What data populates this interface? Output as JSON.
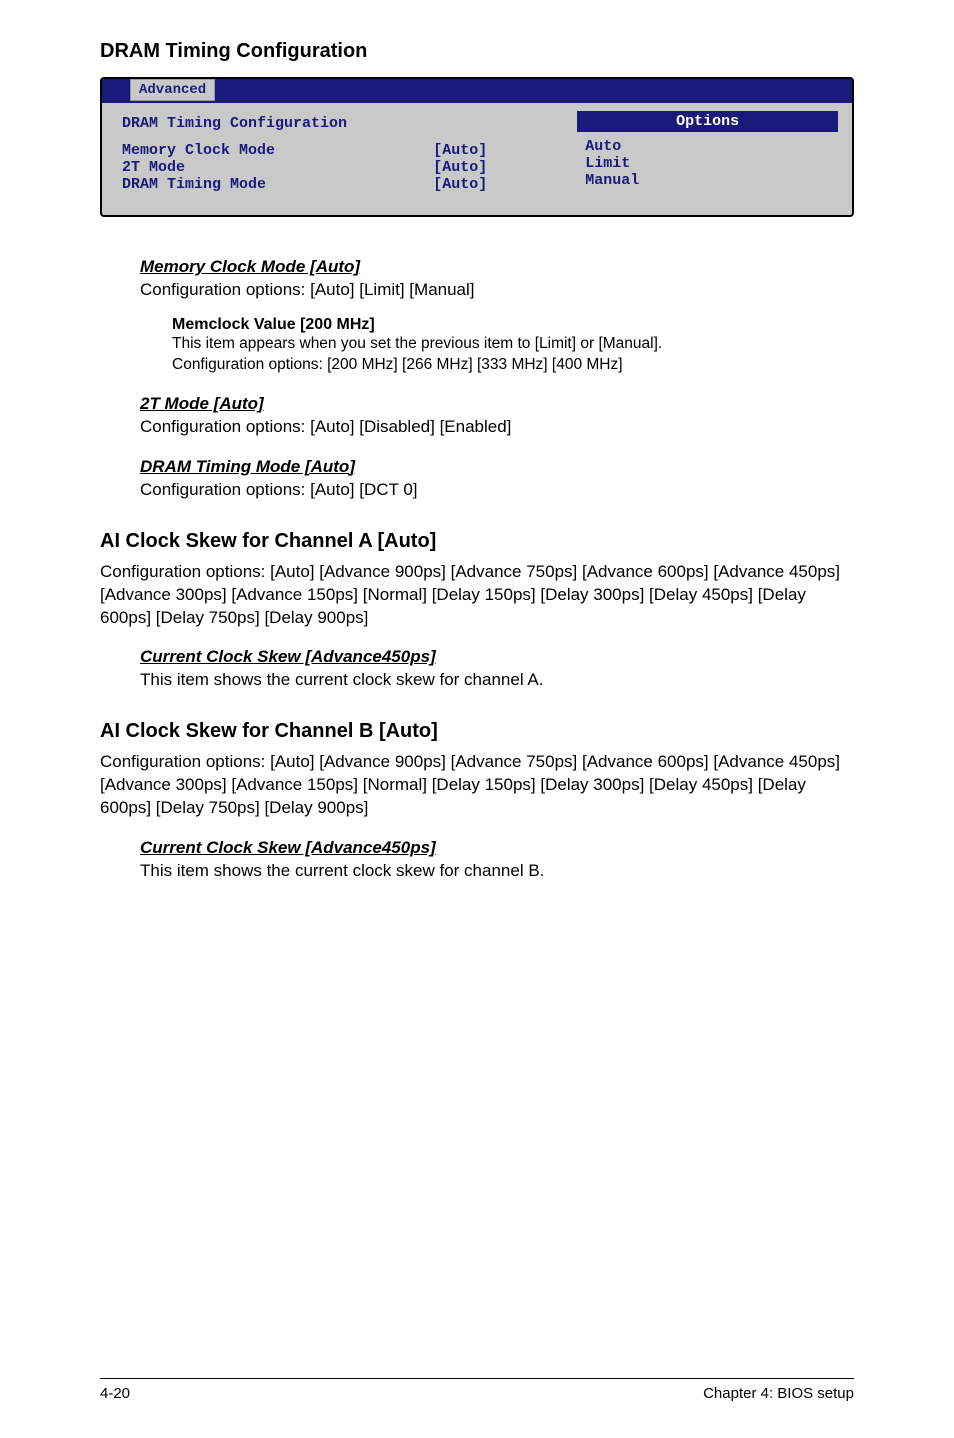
{
  "section_title": "DRAM Timing Configuration",
  "bios": {
    "tab": "Advanced",
    "panel_title": "DRAM Timing Configuration",
    "rows": [
      {
        "label": "Memory Clock Mode",
        "value": "[Auto]"
      },
      {
        "label": "2T Mode",
        "value": "[Auto]"
      },
      {
        "label": "DRAM Timing Mode",
        "value": "[Auto]"
      }
    ],
    "options_header": "Options",
    "options": [
      "Auto",
      "Limit",
      "Manual"
    ]
  },
  "mem_clock": {
    "title": "Memory Clock Mode [Auto]",
    "desc": "Configuration options: [Auto] [Limit] [Manual]"
  },
  "memclock_value": {
    "title": "Memclock Value [200 MHz]",
    "line1": "This item appears when you set the previous item to [Limit] or [Manual].",
    "line2": "Configuration options: [200 MHz] [266 MHz] [333 MHz] [400 MHz]"
  },
  "tmode": {
    "title": "2T Mode [Auto]",
    "desc": "Configuration options: [Auto] [Disabled] [Enabled]"
  },
  "dram_timing": {
    "title": "DRAM Timing Mode [Auto]",
    "desc": "Configuration options: [Auto] [DCT 0]"
  },
  "skew_a": {
    "heading": "AI Clock Skew for Channel A [Auto]",
    "body": "Configuration options: [Auto] [Advance 900ps] [Advance 750ps] [Advance 600ps] [Advance 450ps] [Advance 300ps] [Advance 150ps] [Normal] [Delay 150ps] [Delay 300ps] [Delay 450ps] [Delay 600ps] [Delay 750ps] [Delay 900ps]",
    "sub_title": "Current Clock Skew [Advance450ps]",
    "sub_desc": "This item shows the current clock skew for channel A."
  },
  "skew_b": {
    "heading": "AI Clock Skew for Channel B [Auto]",
    "body": "Configuration options: [Auto] [Advance 900ps] [Advance 750ps] [Advance 600ps] [Advance 450ps] [Advance 300ps] [Advance 150ps] [Normal] [Delay 150ps] [Delay 300ps] [Delay 450ps] [Delay 600ps] [Delay 750ps] [Delay 900ps]",
    "sub_title": "Current Clock Skew [Advance450ps]",
    "sub_desc": "This item shows the current clock skew for channel B."
  },
  "footer": {
    "left": "4-20",
    "right": "Chapter 4: BIOS setup"
  }
}
